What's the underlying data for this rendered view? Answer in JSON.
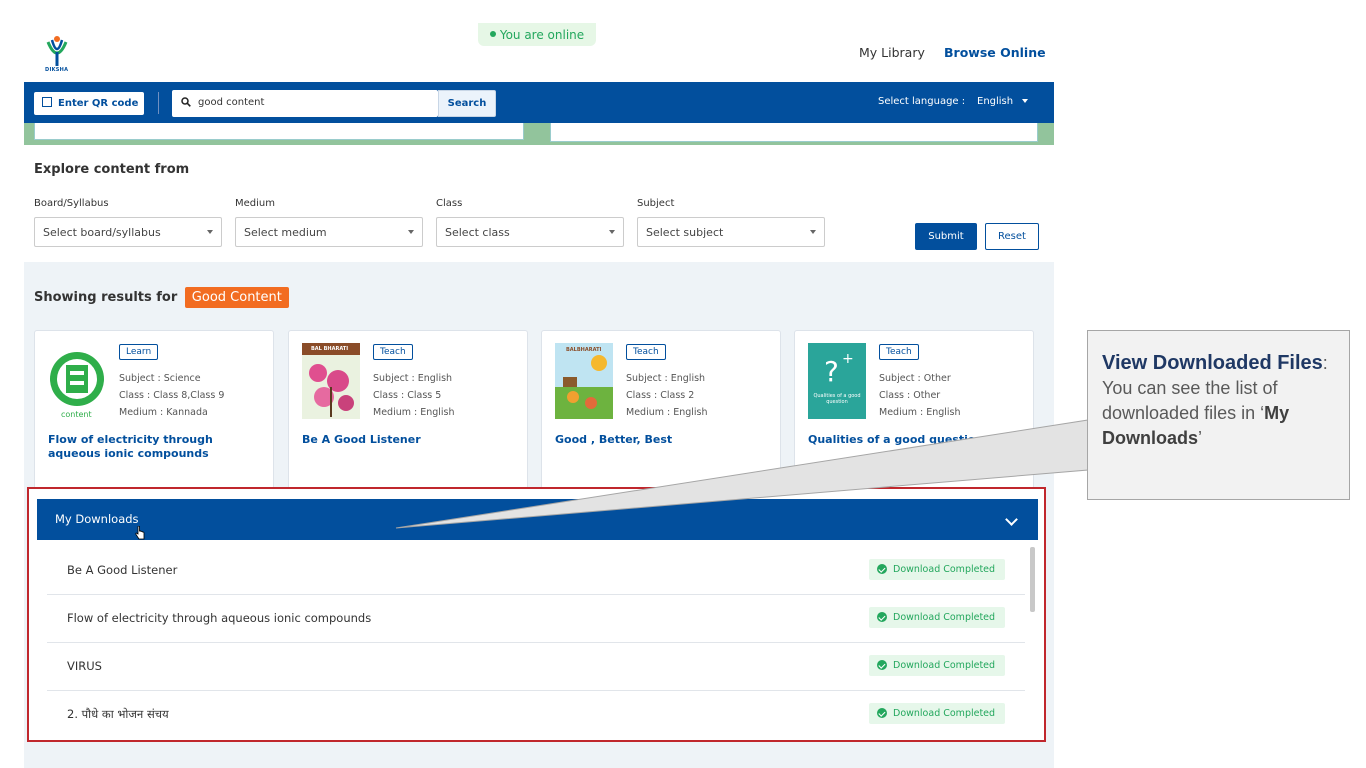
{
  "header": {
    "logo_text": "DIKSHA",
    "online_status": "You are online",
    "my_library": "My Library",
    "browse_online": "Browse Online"
  },
  "navbar": {
    "qr_label": "Enter QR code",
    "search_value": "good content",
    "search_button": "Search",
    "language_label": "Select language :",
    "language_value": "English"
  },
  "explore": {
    "title": "Explore content from",
    "filters": [
      {
        "label": "Board/Syllabus",
        "placeholder": "Select board/syllabus"
      },
      {
        "label": "Medium",
        "placeholder": "Select medium"
      },
      {
        "label": "Class",
        "placeholder": "Select class"
      },
      {
        "label": "Subject",
        "placeholder": "Select subject"
      }
    ],
    "submit": "Submit",
    "reset": "Reset"
  },
  "results": {
    "showing": "Showing results for",
    "query": "Good Content",
    "cards": [
      {
        "tag": "Learn",
        "subject": "Subject : Science",
        "class": "Class : Class 8,Class 9",
        "medium": "Medium : Kannada",
        "title": "Flow of electricity through aqueous ionic compounds",
        "thumb_text": "content"
      },
      {
        "tag": "Teach",
        "subject": "Subject : English",
        "class": "Class : Class 5",
        "medium": "Medium : English",
        "title": "Be A Good Listener",
        "thumb_text": "BAL BHARATI"
      },
      {
        "tag": "Teach",
        "subject": "Subject : English",
        "class": "Class : Class 2",
        "medium": "Medium : English",
        "title": "Good , Better, Best",
        "thumb_text": "BALBHARATI"
      },
      {
        "tag": "Teach",
        "subject": "Subject : Other",
        "class": "Class : Other",
        "medium": "Medium : English",
        "title": "Qualities of a good question",
        "thumb_text": "Qualities of a good question"
      }
    ]
  },
  "downloads": {
    "title": "My Downloads",
    "items": [
      {
        "name": "Be A Good Listener",
        "status": "Download Completed"
      },
      {
        "name": "Flow of electricity through aqueous ionic compounds",
        "status": "Download Completed"
      },
      {
        "name": "VIRUS",
        "status": "Download Completed"
      },
      {
        "name": "2. पौधे का भोजन संचय",
        "status": "Download Completed"
      }
    ]
  },
  "callout": {
    "title": "View Downloaded Files",
    "title_suffix": ":",
    "body_prefix": "You can see the list of downloaded files in ‘",
    "body_bold": "My Downloads",
    "body_suffix": "’"
  },
  "colors": {
    "brand_blue": "#024f9d",
    "accent_orange": "#f26c21",
    "success_green": "#23a75d",
    "highlight_red": "#c0272d"
  }
}
